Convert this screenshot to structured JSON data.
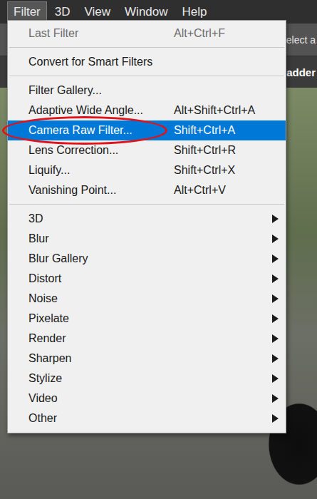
{
  "menubar": {
    "items": [
      {
        "label": "Filter",
        "selected": true
      },
      {
        "label": "3D",
        "selected": false
      },
      {
        "label": "View",
        "selected": false
      },
      {
        "label": "Window",
        "selected": false
      },
      {
        "label": "Help",
        "selected": false
      }
    ]
  },
  "options_bar": {
    "text": "elect a"
  },
  "document_tab": {
    "title": "adder"
  },
  "menu": {
    "items": [
      {
        "kind": "item",
        "label": "Last Filter",
        "shortcut": "Alt+Ctrl+F",
        "disabled": true,
        "selected": false,
        "circled": false,
        "submenu": false
      },
      {
        "kind": "separator"
      },
      {
        "kind": "item",
        "label": "Convert for Smart Filters",
        "shortcut": "",
        "disabled": false,
        "selected": false,
        "circled": false,
        "submenu": false
      },
      {
        "kind": "separator"
      },
      {
        "kind": "item",
        "label": "Filter Gallery...",
        "shortcut": "",
        "disabled": false,
        "selected": false,
        "circled": false,
        "submenu": false
      },
      {
        "kind": "item",
        "label": "Adaptive Wide Angle...",
        "shortcut": "Alt+Shift+Ctrl+A",
        "disabled": false,
        "selected": false,
        "circled": false,
        "submenu": false
      },
      {
        "kind": "item",
        "label": "Camera Raw Filter...",
        "shortcut": "Shift+Ctrl+A",
        "disabled": false,
        "selected": true,
        "circled": true,
        "submenu": false
      },
      {
        "kind": "item",
        "label": "Lens Correction...",
        "shortcut": "Shift+Ctrl+R",
        "disabled": false,
        "selected": false,
        "circled": false,
        "submenu": false
      },
      {
        "kind": "item",
        "label": "Liquify...",
        "shortcut": "Shift+Ctrl+X",
        "disabled": false,
        "selected": false,
        "circled": false,
        "submenu": false
      },
      {
        "kind": "item",
        "label": "Vanishing Point...",
        "shortcut": "Alt+Ctrl+V",
        "disabled": false,
        "selected": false,
        "circled": false,
        "submenu": false
      },
      {
        "kind": "separator"
      },
      {
        "kind": "item",
        "label": "3D",
        "shortcut": "",
        "disabled": false,
        "selected": false,
        "circled": false,
        "submenu": true
      },
      {
        "kind": "item",
        "label": "Blur",
        "shortcut": "",
        "disabled": false,
        "selected": false,
        "circled": false,
        "submenu": true
      },
      {
        "kind": "item",
        "label": "Blur Gallery",
        "shortcut": "",
        "disabled": false,
        "selected": false,
        "circled": false,
        "submenu": true
      },
      {
        "kind": "item",
        "label": "Distort",
        "shortcut": "",
        "disabled": false,
        "selected": false,
        "circled": false,
        "submenu": true
      },
      {
        "kind": "item",
        "label": "Noise",
        "shortcut": "",
        "disabled": false,
        "selected": false,
        "circled": false,
        "submenu": true
      },
      {
        "kind": "item",
        "label": "Pixelate",
        "shortcut": "",
        "disabled": false,
        "selected": false,
        "circled": false,
        "submenu": true
      },
      {
        "kind": "item",
        "label": "Render",
        "shortcut": "",
        "disabled": false,
        "selected": false,
        "circled": false,
        "submenu": true
      },
      {
        "kind": "item",
        "label": "Sharpen",
        "shortcut": "",
        "disabled": false,
        "selected": false,
        "circled": false,
        "submenu": true
      },
      {
        "kind": "item",
        "label": "Stylize",
        "shortcut": "",
        "disabled": false,
        "selected": false,
        "circled": false,
        "submenu": true
      },
      {
        "kind": "item",
        "label": "Video",
        "shortcut": "",
        "disabled": false,
        "selected": false,
        "circled": false,
        "submenu": true
      },
      {
        "kind": "item",
        "label": "Other",
        "shortcut": "",
        "disabled": false,
        "selected": false,
        "circled": false,
        "submenu": true
      }
    ]
  }
}
